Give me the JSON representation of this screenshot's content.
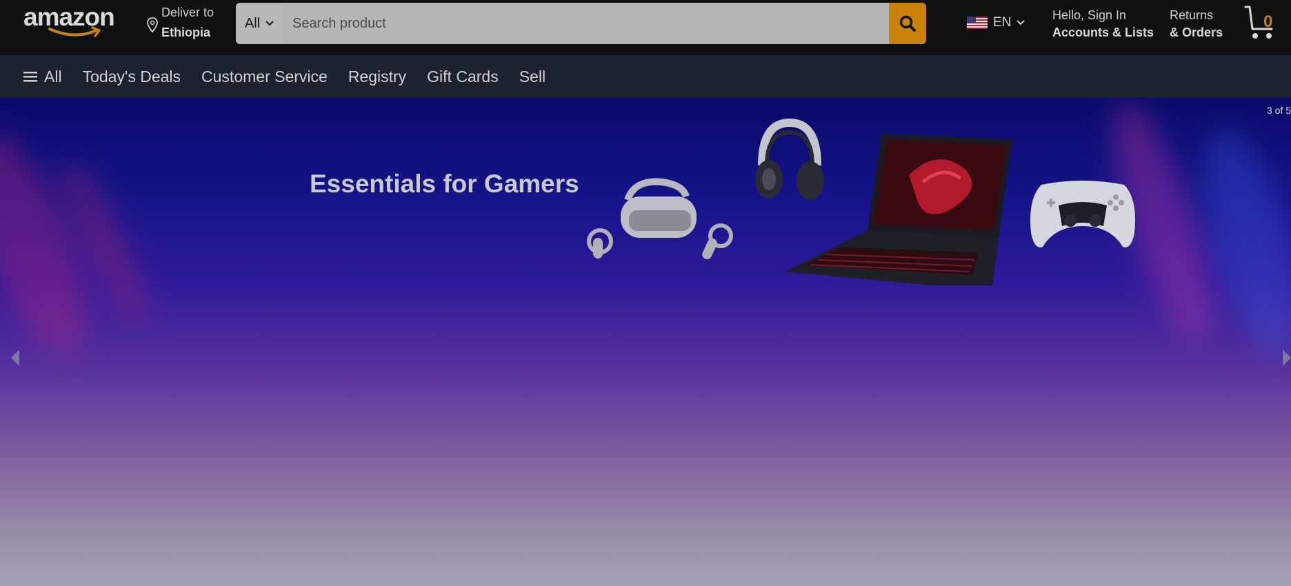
{
  "header": {
    "logo_text": "amazon",
    "deliver_label": "Deliver to",
    "deliver_location": "Ethiopia",
    "search": {
      "category": "All",
      "placeholder": "Search product"
    },
    "language": "EN",
    "account_greeting": "Hello, Sign In",
    "account_label": "Accounts & Lists",
    "returns_label": "Returns",
    "orders_label": "& Orders",
    "cart_count": "0"
  },
  "nav": {
    "items": [
      {
        "label": "All"
      },
      {
        "label": "Today's Deals"
      },
      {
        "label": "Customer Service"
      },
      {
        "label": "Registry"
      },
      {
        "label": "Gift Cards"
      },
      {
        "label": "Sell"
      }
    ]
  },
  "hero": {
    "title": "Essentials for Gamers",
    "pager": "3 of 5"
  },
  "icons": {
    "location": "location-pin-icon",
    "search": "search-icon",
    "flag": "us-flag-icon",
    "chevron": "chevron-down-icon",
    "menu": "hamburger-menu-icon",
    "cart": "cart-icon",
    "prev": "carousel-prev-icon",
    "next": "carousel-next-icon"
  },
  "colors": {
    "accent": "#c98308",
    "topbar": "#0f1111",
    "navbar": "#1c232e"
  }
}
